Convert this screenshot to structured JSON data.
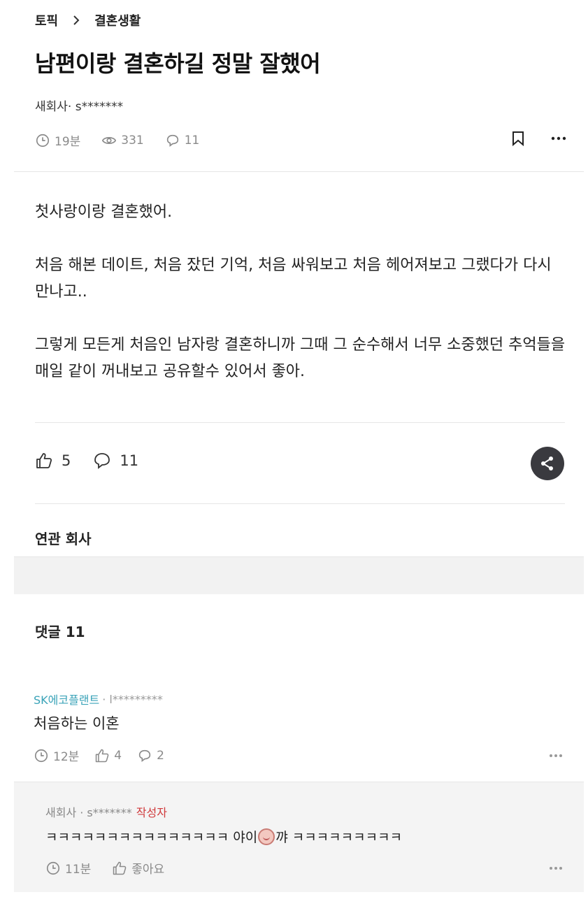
{
  "breadcrumb": {
    "root": "토픽",
    "current": "결혼생활"
  },
  "post": {
    "title": "남편이랑 결혼하길 정말 잘했어",
    "author": "새회사· s*******",
    "time": "19분",
    "views": "331",
    "comment_count": "11",
    "paragraphs": [
      "첫사랑이랑 결혼했어.",
      "처음 해본 데이트, 처음 잤던 기억, 처음 싸워보고 처음 헤어져보고 그랬다가 다시 만나고..",
      "그렇게 모든게 처음인 남자랑 결혼하니까 그때 그 순수해서 너무 소중했던 추억들을 매일 같이 꺼내보고 공유할수 있어서 좋아."
    ],
    "likes": "5",
    "comments": "11"
  },
  "related_section": {
    "title": "연관 회사"
  },
  "comments_section": {
    "title": "댓글 11"
  },
  "comment1": {
    "company": "SK에코플랜트",
    "user": "· l*********",
    "text": "처음하는 이혼",
    "time": "12분",
    "likes": "4",
    "replies": "2"
  },
  "reply1": {
    "user": "새회사 · s*******",
    "author_tag": "작성자",
    "text_before": "ㅋㅋㅋㅋㅋㅋㅋㅋㅋㅋㅋㅋㅋㅋㅋ 야이",
    "text_after": "꺄 ㅋㅋㅋㅋㅋㅋㅋㅋㅋ",
    "time": "11분",
    "like_label": "좋아요"
  },
  "colors": {
    "accent_link": "#3aa3b8",
    "author_tag": "#d0393b",
    "share_bg": "#3a3a3f"
  },
  "icons": [
    "chevron-right-icon",
    "clock-icon",
    "eye-icon",
    "comment-icon",
    "bookmark-icon",
    "more-icon",
    "thumbs-up-icon",
    "share-icon",
    "emoji-icon"
  ]
}
